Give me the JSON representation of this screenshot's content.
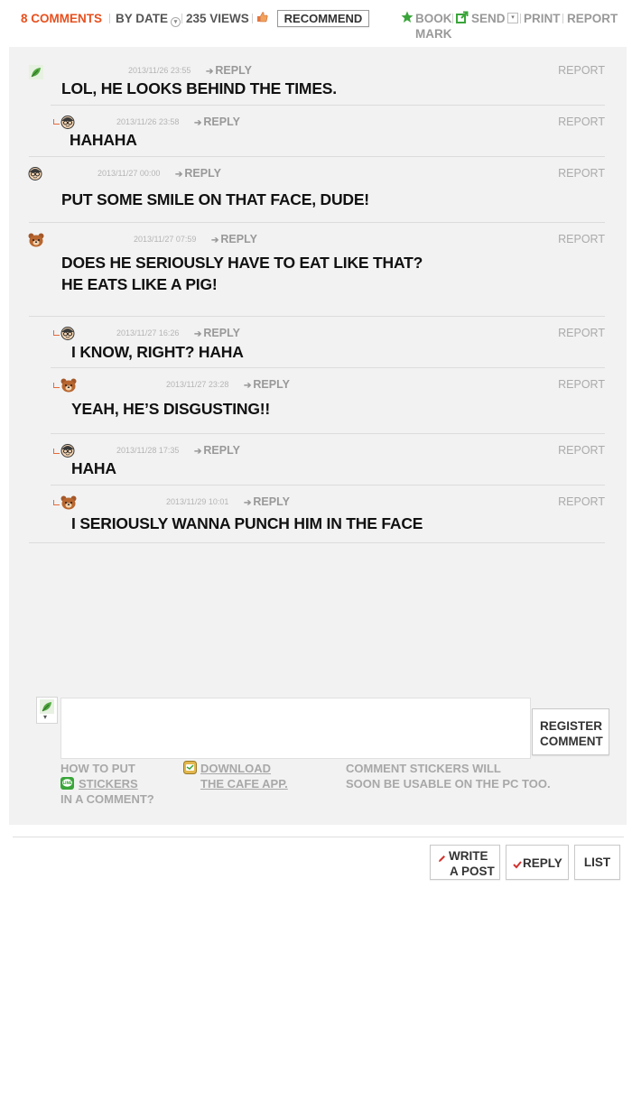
{
  "toolbar": {
    "comments": "8 COMMENTS",
    "sort": "BY DATE",
    "views": "235 VIEWS",
    "recommend": "RECOMMEND",
    "bookmark_1": "BOOK",
    "bookmark_2": "MARK",
    "send": "SEND",
    "print": "PRINT",
    "report": "REPORT"
  },
  "reply_label": "REPLY",
  "report_label": "REPORT",
  "comments": [
    {
      "avatar": "leaf-icon",
      "date": "2013/11/26 23:55",
      "text": "LOL, HE LOOKS BEHIND THE TIMES."
    },
    {
      "avatar": "glasses-face-icon",
      "date": "2013/11/26 23:58",
      "text": "HAHAHA"
    },
    {
      "avatar": "glasses-face-icon",
      "date": "2013/11/27 00:00",
      "text": "PUT SOME SMILE ON THAT FACE, DUDE!"
    },
    {
      "avatar": "bear-icon",
      "date": "2013/11/27 07:59",
      "text": "DOES HE SERIOUSLY HAVE TO EAT LIKE THAT?\nHE EATS LIKE A PIG!"
    },
    {
      "avatar": "glasses-face-icon",
      "date": "2013/11/27 16:26",
      "text": "I KNOW, RIGHT? HAHA"
    },
    {
      "avatar": "bear-icon",
      "date": "2013/11/27 23:28",
      "text": "YEAH, HE’S DISGUSTING!!"
    },
    {
      "avatar": "glasses-face-icon",
      "date": "2013/11/28 17:35",
      "text": "HAHA"
    },
    {
      "avatar": "bear-icon",
      "date": "2013/11/29 10:01",
      "text": "I SERIOUSLY WANNA PUNCH HIM IN THE FACE"
    }
  ],
  "composer": {
    "register_1": "REGISTER",
    "register_2": "COMMENT",
    "how_1": "HOW TO PUT",
    "how_2": "STICKERS",
    "how_3": "IN A COMMENT?",
    "download_1": "DOWNLOAD",
    "download_2": "THE CAFE APP.",
    "soon_1": "COMMENT STICKERS WILL",
    "soon_2": "SOON BE USABLE ON THE PC TOO."
  },
  "bottom_buttons": {
    "write_1": "WRITE",
    "write_2": "A POST",
    "reply": "REPLY",
    "list": "LIST"
  },
  "colors": {
    "accent": "#e8501e",
    "green": "#3aa53a",
    "check": "#d2322d"
  }
}
